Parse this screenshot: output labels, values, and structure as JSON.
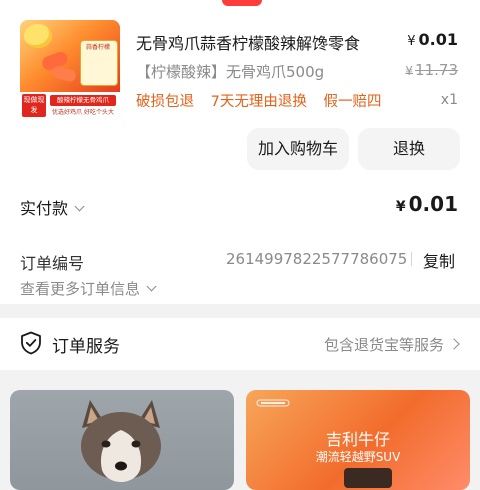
{
  "product": {
    "title": "无骨鸡爪蒜香柠檬酸辣解馋零食",
    "price_symbol": "¥",
    "price": "0.01",
    "sku": "【柠檬酸辣】无骨鸡爪500g",
    "original_price": "11.73",
    "services": [
      "破损包退",
      "7天无理由退换",
      "假一赔四"
    ],
    "quantity": "x1",
    "image": {
      "badge": "现做现发",
      "line1": "酸辣柠檬无骨鸡爪",
      "line2": "优选好鸡爪 好吃个头大",
      "pack_label": "蒜香柠檬"
    }
  },
  "actions": {
    "add_to_cart": "加入购物车",
    "return_exchange": "退换"
  },
  "payment": {
    "label": "实付款",
    "symbol": "¥",
    "amount": "0.01"
  },
  "order": {
    "number_label": "订单编号",
    "number": "2614997822577786075",
    "copy": "复制",
    "more_info": "查看更多订单信息"
  },
  "service": {
    "title": "订单服务",
    "subtitle": "包含退货宝等服务",
    "icon": "shield-check-icon"
  },
  "recommend": {
    "right_title": "吉利牛仔",
    "right_subtitle": "潮流轻越野SUV"
  }
}
